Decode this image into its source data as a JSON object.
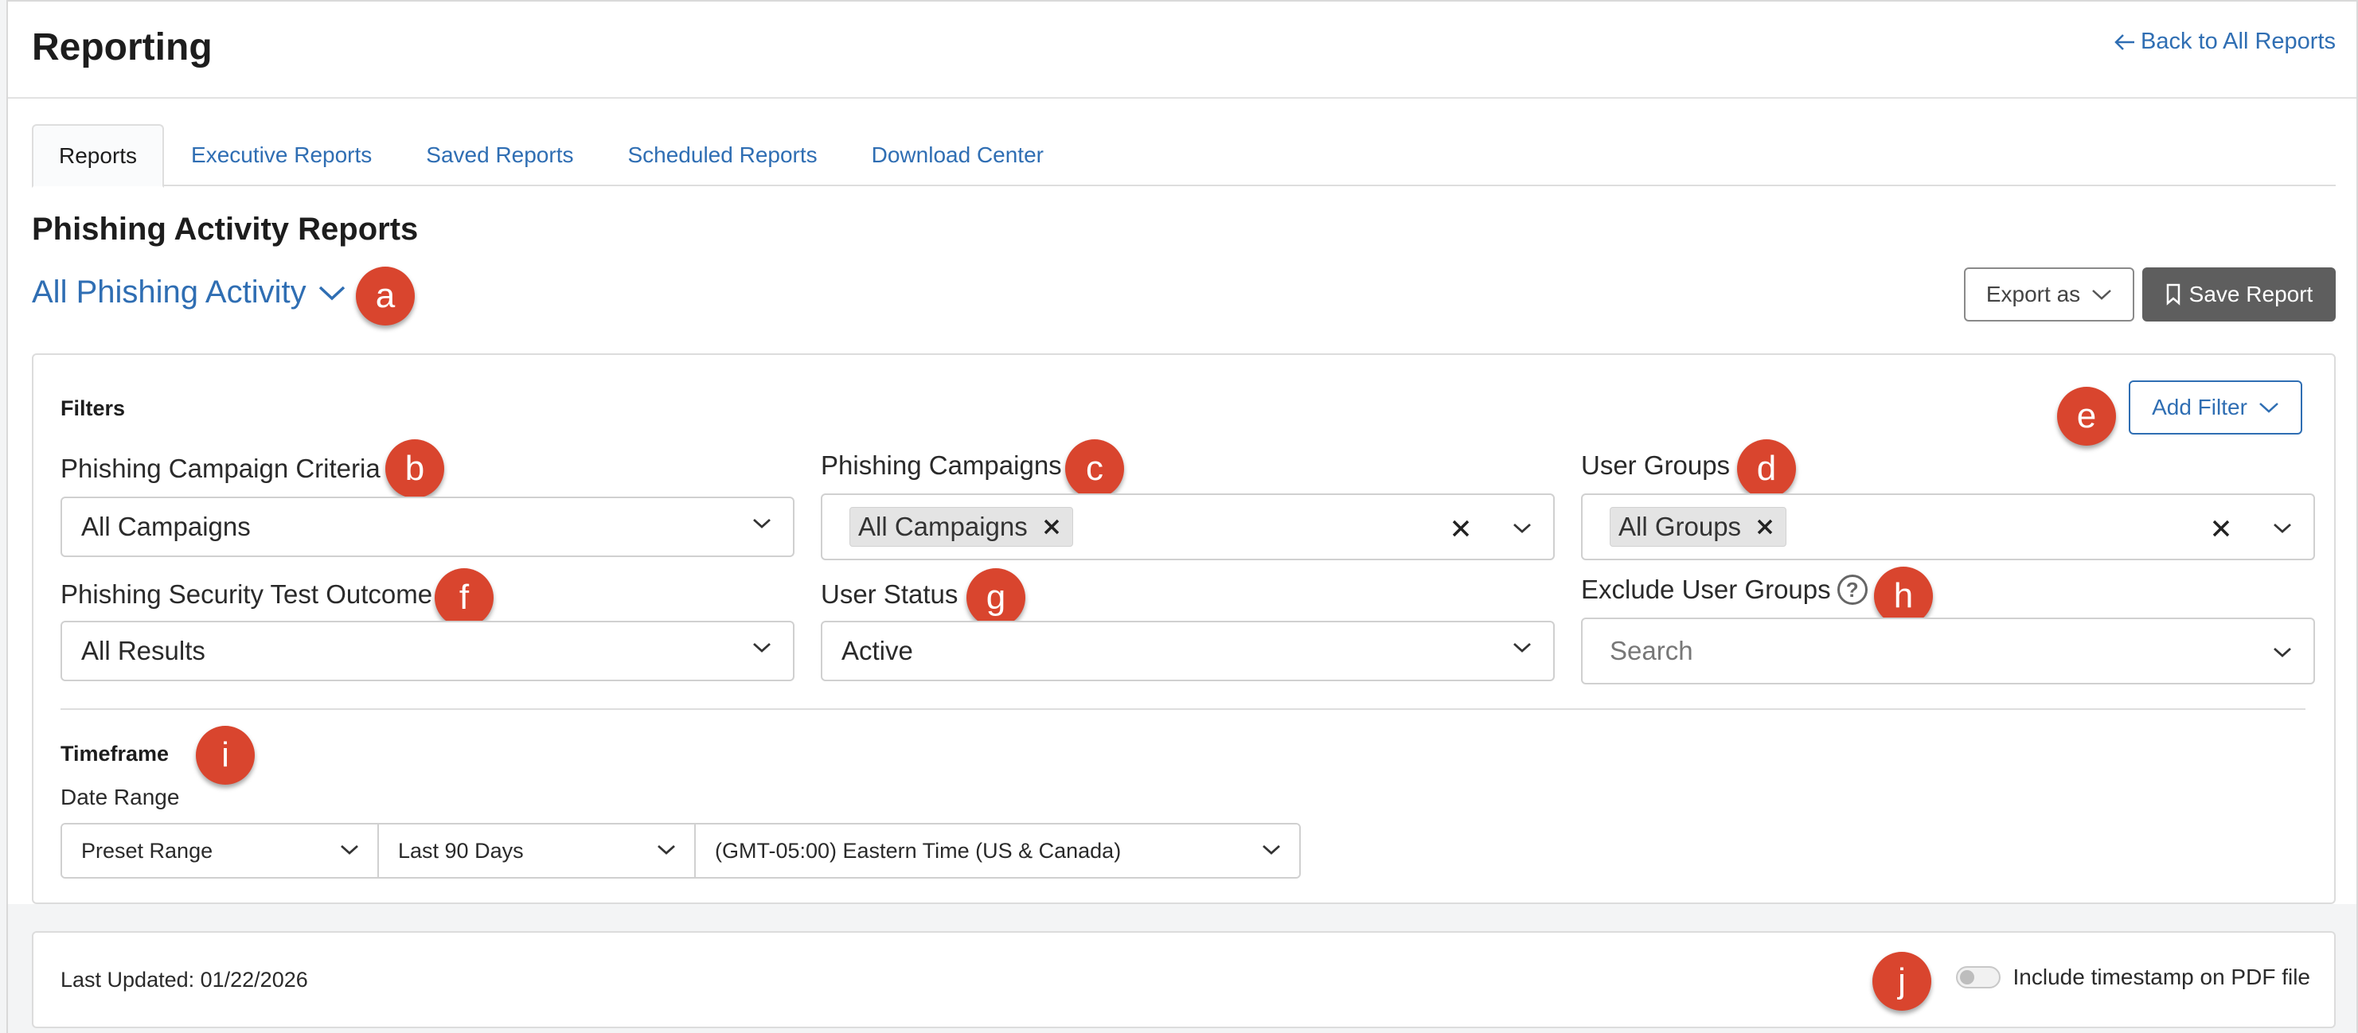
{
  "header": {
    "title": "Reporting",
    "back_link": "Back to All Reports"
  },
  "tabs": [
    {
      "label": "Reports",
      "active": true
    },
    {
      "label": "Executive Reports"
    },
    {
      "label": "Saved Reports"
    },
    {
      "label": "Scheduled Reports"
    },
    {
      "label": "Download Center"
    }
  ],
  "section": {
    "title": "Phishing Activity Reports",
    "report_selector": "All Phishing Activity",
    "export_label": "Export as",
    "save_label": "Save Report"
  },
  "filters": {
    "title": "Filters",
    "add_filter": "Add Filter",
    "campaign_criteria": {
      "label": "Phishing Campaign Criteria",
      "value": "All Campaigns"
    },
    "campaigns": {
      "label": "Phishing Campaigns",
      "chip": "All Campaigns"
    },
    "user_groups": {
      "label": "User Groups",
      "chip": "All Groups"
    },
    "test_outcome": {
      "label": "Phishing Security Test Outcome",
      "value": "All Results"
    },
    "user_status": {
      "label": "User Status",
      "value": "Active"
    },
    "exclude_groups": {
      "label": "Exclude User Groups",
      "placeholder": "Search"
    }
  },
  "timeframe": {
    "title": "Timeframe",
    "date_range_label": "Date Range",
    "range_type": "Preset Range",
    "range_value": "Last 90 Days",
    "timezone": "(GMT-05:00) Eastern Time (US & Canada)"
  },
  "footer": {
    "last_updated": "Last Updated: 01/22/2026",
    "timestamp_toggle_label": "Include timestamp on PDF file",
    "timestamp_toggle_on": false
  },
  "annotations": [
    "a",
    "b",
    "c",
    "d",
    "e",
    "f",
    "g",
    "h",
    "i",
    "j"
  ],
  "colors": {
    "link": "#2f6eb3",
    "badge": "#d9452e",
    "save_button": "#5e5e5e"
  }
}
